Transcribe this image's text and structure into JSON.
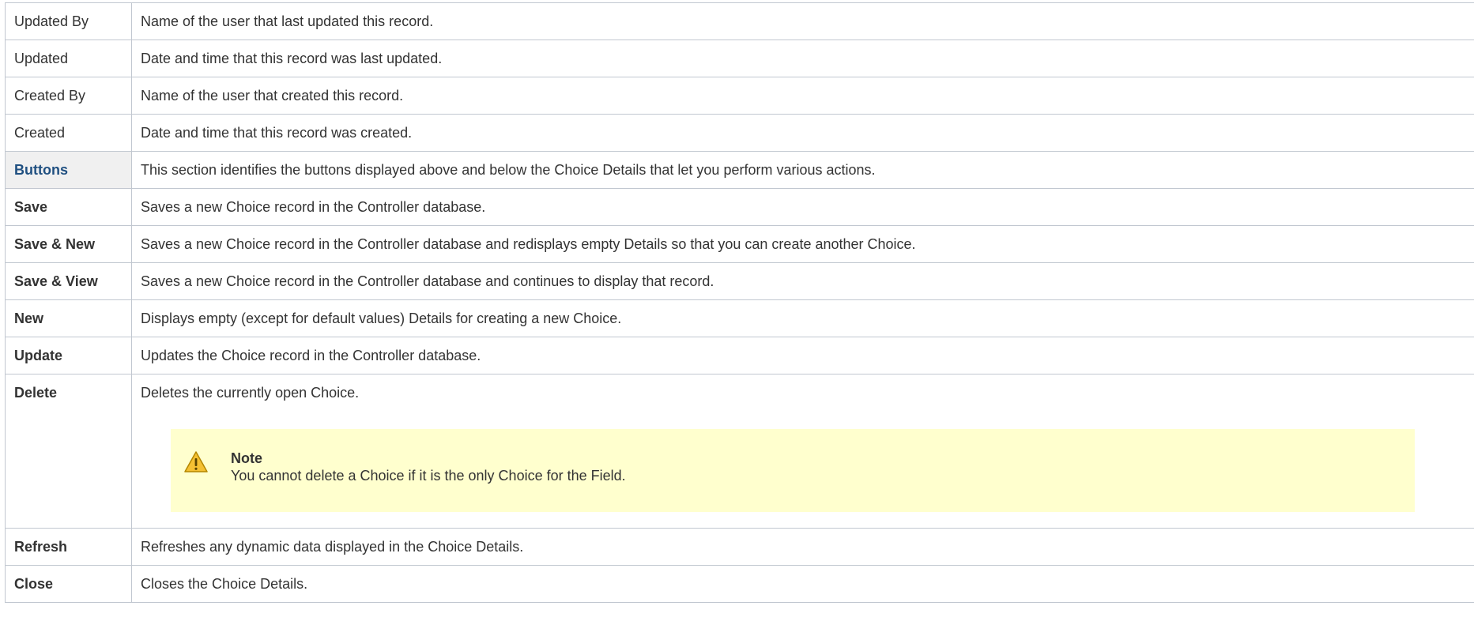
{
  "rows": [
    {
      "name": "Updated By",
      "desc": "Name of the user that last updated this record."
    },
    {
      "name": "Updated",
      "desc": "Date and time that this record was last updated."
    },
    {
      "name": "Created By",
      "desc": "Name of the user that created this record."
    },
    {
      "name": "Created",
      "desc": "Date and time that this record was created."
    },
    {
      "name": "Buttons",
      "desc": "This section identifies the buttons displayed above and below the Choice Details that let you perform various actions."
    },
    {
      "name": "Save",
      "desc": "Saves a new Choice record in the Controller database."
    },
    {
      "name": "Save & New",
      "desc": "Saves a new Choice record in the Controller database and redisplays empty Details so that you can create another Choice."
    },
    {
      "name": "Save & View",
      "desc": "Saves a new Choice record in the Controller database and continues to display that record."
    },
    {
      "name": "New",
      "desc": "Displays empty (except for default values) Details for creating a new Choice."
    },
    {
      "name": "Update",
      "desc": "Updates the Choice record in the Controller database."
    },
    {
      "name": "Delete",
      "desc": "Deletes the currently open Choice."
    },
    {
      "name": "Refresh",
      "desc": "Refreshes any dynamic data displayed in the Choice Details."
    },
    {
      "name": "Close",
      "desc": "Closes the Choice Details."
    }
  ],
  "note": {
    "icon": "warning-icon",
    "title": "Note",
    "text": "You cannot delete a Choice if it is the only Choice for the Field."
  },
  "colors": {
    "section_header_bg": "#f0f0f0",
    "section_header_text": "#205081",
    "note_bg": "#ffffce",
    "border": "#c1c7d0"
  }
}
